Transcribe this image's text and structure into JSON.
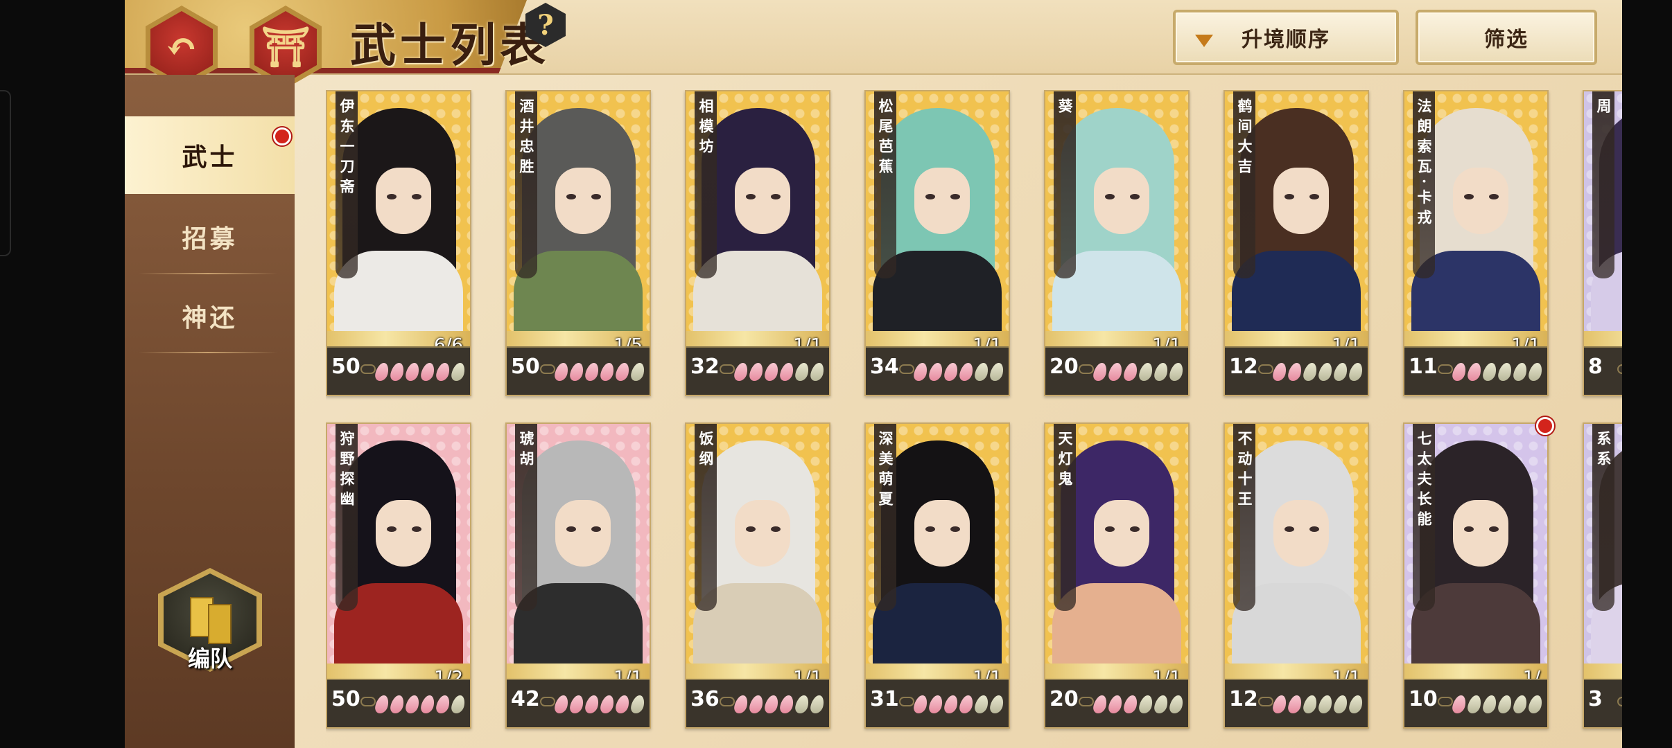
{
  "header": {
    "title": "武士列表",
    "back_icon": "↶",
    "home_icon": "⛩",
    "help_label": "?",
    "sort_label": "升境顺序",
    "filter_label": "筛选"
  },
  "sidebar": {
    "items": [
      {
        "label": "武士"
      },
      {
        "label": "招募"
      },
      {
        "label": "神还"
      }
    ],
    "formation_label": "编队"
  },
  "cards": [
    {
      "name": "伊东一刀斋",
      "level": "50",
      "count": "6/6",
      "petals": 5,
      "bg": "#f1c24f",
      "hair": "#1b1718",
      "body": "#eceae6"
    },
    {
      "name": "酒井忠胜",
      "level": "50",
      "count": "1/5",
      "petals": 5,
      "bg": "#f1c24f",
      "hair": "#5a5a58",
      "body": "#6e8650"
    },
    {
      "name": "相模坊",
      "level": "32",
      "count": "1/1",
      "petals": 4,
      "bg": "#f1c24f",
      "hair": "#2a2040",
      "body": "#e6e1d8"
    },
    {
      "name": "松尾芭蕉",
      "level": "34",
      "count": "1/1",
      "petals": 4,
      "bg": "#f1c24f",
      "hair": "#7dc6b3",
      "body": "#1f2126"
    },
    {
      "name": "葵",
      "level": "20",
      "count": "1/1",
      "petals": 3,
      "bg": "#f1c24f",
      "hair": "#9fd3c9",
      "body": "#cfe4ea"
    },
    {
      "name": "鹤间大吉",
      "level": "12",
      "count": "1/1",
      "petals": 2,
      "bg": "#f1c24f",
      "hair": "#4a2f22",
      "body": "#1f2b55"
    },
    {
      "name": "法朗索瓦·卡戎",
      "level": "11",
      "count": "1/1",
      "petals": 2,
      "bg": "#f1c24f",
      "hair": "#e6ddcf",
      "body": "#2c3467"
    },
    {
      "name": "周",
      "level": "8",
      "count": "",
      "petals": 1,
      "bg": "#cfc3e6",
      "hair": "#3a2d52",
      "body": "#d6cbe8"
    },
    {
      "name": "狩野探幽",
      "level": "50",
      "count": "1/2",
      "petals": 5,
      "bg": "#f2b8bf",
      "hair": "#15121a",
      "body": "#9d2420"
    },
    {
      "name": "琥胡",
      "level": "42",
      "count": "1/1",
      "petals": 5,
      "bg": "#f2b8bf",
      "hair": "#b8b8b8",
      "body": "#2d2d2d"
    },
    {
      "name": "饭纲",
      "level": "36",
      "count": "1/1",
      "petals": 4,
      "bg": "#f1c24f",
      "hair": "#e7e5e0",
      "body": "#d9cdb6"
    },
    {
      "name": "深美萌夏",
      "level": "31",
      "count": "1/1",
      "petals": 4,
      "bg": "#f1c24f",
      "hair": "#141214",
      "body": "#1b2440"
    },
    {
      "name": "天灯鬼",
      "level": "20",
      "count": "1/1",
      "petals": 3,
      "bg": "#f1c24f",
      "hair": "#3d2766",
      "body": "#e5b08f"
    },
    {
      "name": "不动十王",
      "level": "12",
      "count": "1/1",
      "petals": 2,
      "bg": "#f1c24f",
      "hair": "#dcdcdc",
      "body": "#d8d8d8"
    },
    {
      "name": "七太夫长能",
      "level": "10",
      "count": "1/",
      "petals": 1,
      "bg": "#d4c4ea",
      "hair": "#2b2328",
      "body": "#4d3a3a"
    },
    {
      "name": "系系",
      "level": "3",
      "count": "",
      "petals": 1,
      "bg": "#cfc3e6",
      "hair": "#453a3a",
      "body": "#ddd3ea"
    }
  ],
  "colors": {
    "accent_red": "#d3241c",
    "sidebar_brown": "#6e472d",
    "gold": "#c7aa6b"
  }
}
